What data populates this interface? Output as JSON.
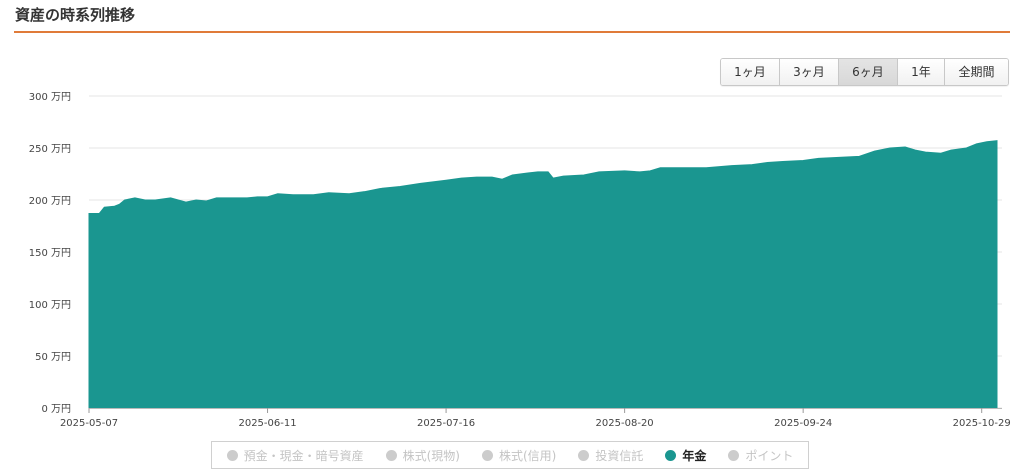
{
  "section": {
    "title": "資産の時系列推移"
  },
  "range_buttons": [
    {
      "label": "1ヶ月",
      "active": false
    },
    {
      "label": "3ヶ月",
      "active": false
    },
    {
      "label": "6ヶ月",
      "active": true
    },
    {
      "label": "1年",
      "active": false
    },
    {
      "label": "全期間",
      "active": false
    }
  ],
  "legend": [
    {
      "label": "預金・現金・暗号資産",
      "visible": false,
      "color": "#cccccc"
    },
    {
      "label": "株式(現物)",
      "visible": false,
      "color": "#cccccc"
    },
    {
      "label": "株式(信用)",
      "visible": false,
      "color": "#cccccc"
    },
    {
      "label": "投資信託",
      "visible": false,
      "color": "#cccccc"
    },
    {
      "label": "年金",
      "visible": true,
      "color": "#1a9690"
    },
    {
      "label": "ポイント",
      "visible": false,
      "color": "#cccccc"
    }
  ],
  "chart_data": {
    "type": "area",
    "x_start": "2025-05-07",
    "x_end": "2025-11-01",
    "x_tick_labels": [
      "2025-05-07",
      "2025-06-11",
      "2025-07-16",
      "2025-08-20",
      "2025-09-24",
      "2025-10-29"
    ],
    "y_tick_labels": [
      "0 万円",
      "50 万円",
      "100 万円",
      "150 万円",
      "200 万円",
      "250 万円",
      "300 万円"
    ],
    "ylim": [
      0,
      300
    ],
    "grid": true,
    "color": "#1a9690",
    "series": [
      {
        "name": "年金",
        "points": [
          [
            "2025-05-07",
            187
          ],
          [
            "2025-05-09",
            187
          ],
          [
            "2025-05-10",
            193
          ],
          [
            "2025-05-12",
            194
          ],
          [
            "2025-05-13",
            196
          ],
          [
            "2025-05-14",
            200
          ],
          [
            "2025-05-16",
            202
          ],
          [
            "2025-05-18",
            200
          ],
          [
            "2025-05-20",
            200
          ],
          [
            "2025-05-23",
            202
          ],
          [
            "2025-05-26",
            198
          ],
          [
            "2025-05-28",
            200
          ],
          [
            "2025-05-30",
            199
          ],
          [
            "2025-06-01",
            202
          ],
          [
            "2025-06-04",
            202
          ],
          [
            "2025-06-07",
            202
          ],
          [
            "2025-06-09",
            203
          ],
          [
            "2025-06-11",
            203
          ],
          [
            "2025-06-13",
            206
          ],
          [
            "2025-06-16",
            205
          ],
          [
            "2025-06-20",
            205
          ],
          [
            "2025-06-23",
            207
          ],
          [
            "2025-06-27",
            206
          ],
          [
            "2025-06-30",
            208
          ],
          [
            "2025-07-03",
            211
          ],
          [
            "2025-07-07",
            213
          ],
          [
            "2025-07-11",
            216
          ],
          [
            "2025-07-16",
            219
          ],
          [
            "2025-07-19",
            221
          ],
          [
            "2025-07-22",
            222
          ],
          [
            "2025-07-25",
            222
          ],
          [
            "2025-07-27",
            220
          ],
          [
            "2025-07-29",
            224
          ],
          [
            "2025-08-01",
            226
          ],
          [
            "2025-08-03",
            227
          ],
          [
            "2025-08-05",
            227
          ],
          [
            "2025-08-06",
            221
          ],
          [
            "2025-08-08",
            223
          ],
          [
            "2025-08-12",
            224
          ],
          [
            "2025-08-15",
            227
          ],
          [
            "2025-08-20",
            228
          ],
          [
            "2025-08-23",
            227
          ],
          [
            "2025-08-25",
            228
          ],
          [
            "2025-08-27",
            231
          ],
          [
            "2025-09-01",
            231
          ],
          [
            "2025-09-05",
            231
          ],
          [
            "2025-09-10",
            233
          ],
          [
            "2025-09-14",
            234
          ],
          [
            "2025-09-17",
            236
          ],
          [
            "2025-09-20",
            237
          ],
          [
            "2025-09-24",
            238
          ],
          [
            "2025-09-27",
            240
          ],
          [
            "2025-10-01",
            241
          ],
          [
            "2025-10-05",
            242
          ],
          [
            "2025-10-08",
            247
          ],
          [
            "2025-10-11",
            250
          ],
          [
            "2025-10-14",
            251
          ],
          [
            "2025-10-16",
            248
          ],
          [
            "2025-10-18",
            246
          ],
          [
            "2025-10-21",
            245
          ],
          [
            "2025-10-23",
            248
          ],
          [
            "2025-10-26",
            250
          ],
          [
            "2025-10-28",
            254
          ],
          [
            "2025-10-30",
            256
          ],
          [
            "2025-11-01",
            257
          ]
        ]
      }
    ]
  }
}
